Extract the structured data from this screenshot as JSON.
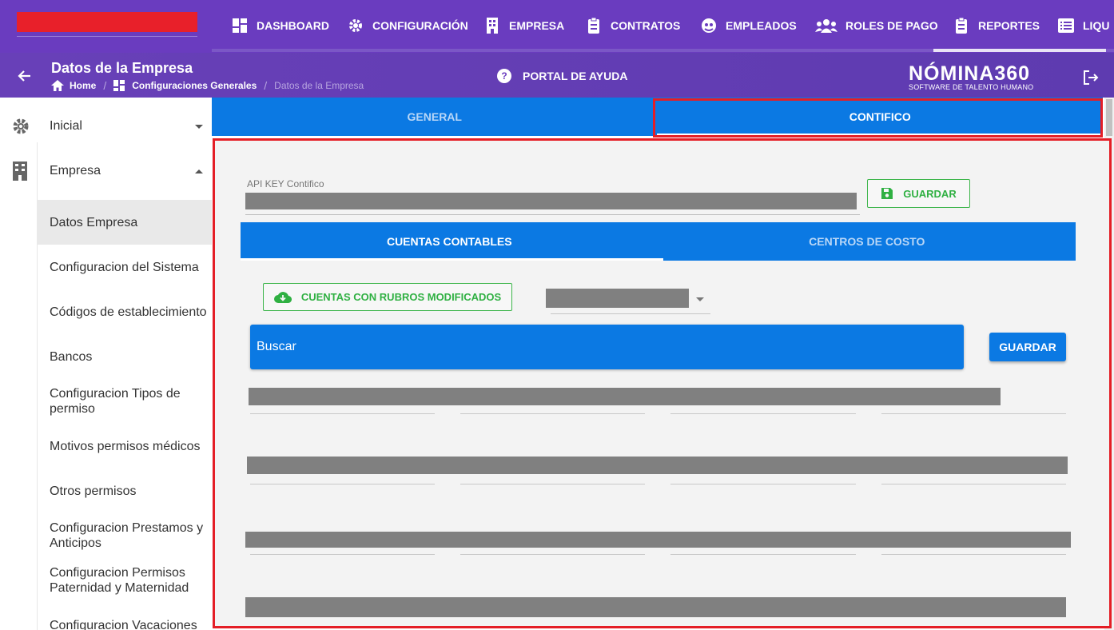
{
  "topnav": {
    "items": [
      {
        "label": "DASHBOARD",
        "icon": "dashboard-icon"
      },
      {
        "label": "CONFIGURACIÓN",
        "icon": "gear-icon"
      },
      {
        "label": "EMPRESA",
        "icon": "building-icon"
      },
      {
        "label": "CONTRATOS",
        "icon": "clipboard-icon"
      },
      {
        "label": "EMPLEADOS",
        "icon": "employees-icon"
      },
      {
        "label": "ROLES DE PAGO",
        "icon": "users-icon"
      },
      {
        "label": "REPORTES",
        "icon": "report-icon"
      },
      {
        "label": "LIQU",
        "icon": "list-icon"
      }
    ]
  },
  "header": {
    "title": "Datos de la Empresa",
    "breadcrumb": [
      "Home",
      "Configuraciones Generales",
      "Datos de la Empresa"
    ],
    "help_label": "PORTAL DE AYUDA",
    "brand_name": "NÓMINA360",
    "brand_tagline": "SOFTWARE DE TALENTO HUMANO"
  },
  "sidebar": {
    "sections": [
      {
        "label": "Inicial",
        "icon": "gear-icon",
        "expanded": false
      },
      {
        "label": "Empresa",
        "icon": "building-icon",
        "expanded": true
      }
    ],
    "items": [
      "Datos Empresa",
      "Configuracion del Sistema",
      "Códigos de establecimiento",
      "Bancos",
      "Configuracion Tipos de permiso",
      "Motivos permisos médicos",
      "Otros permisos",
      "Configuracion Prestamos y Anticipos",
      "Configuracion Permisos Paternidad y Maternidad",
      "Configuracion Vacaciones"
    ],
    "active_index": 0
  },
  "main": {
    "tabs": [
      "GENERAL",
      "CONTIFICO"
    ],
    "active_tab": "CONTIFICO",
    "api_key_label": "API KEY Contifico",
    "save_label": "GUARDAR",
    "subtabs": [
      "CUENTAS CONTABLES",
      "CENTROS DE COSTO"
    ],
    "active_subtab": "CUENTAS CONTABLES",
    "modified_accounts_label": "CUENTAS CON RUBROS MODIFICADOS",
    "search_placeholder": "Buscar",
    "save_button_label": "GUARDAR"
  },
  "colors": {
    "nav_purple": "#6a3cbf",
    "primary_blue": "#0b79e3",
    "success_green": "#2fb042",
    "highlight_red": "#e41e26"
  }
}
